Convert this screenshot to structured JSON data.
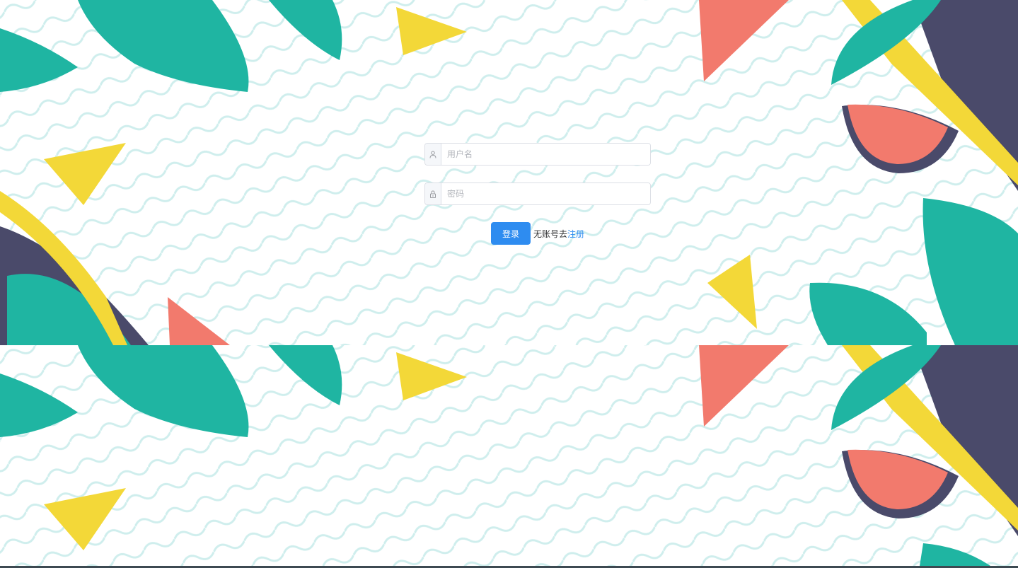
{
  "login": {
    "username_placeholder": "用户名",
    "password_placeholder": "密码",
    "login_button": "登录",
    "no_account_text": "无账号去",
    "register_link": "注册"
  },
  "icons": {
    "username": "user-icon",
    "password": "lock-icon"
  },
  "colors": {
    "primary": "#2e8cf0",
    "link": "#2d8cf0",
    "leaf": "#1fb5a2",
    "watermelon": "#f27a6d",
    "lemon": "#f3d838",
    "navy": "#4a4a6a"
  }
}
